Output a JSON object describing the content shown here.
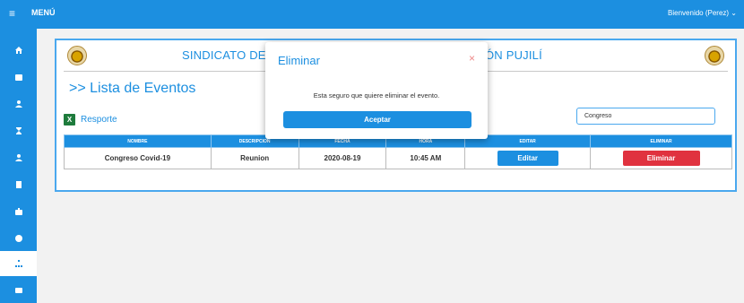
{
  "topbar": {
    "menu_icon": "≡",
    "menu_label": "MENÚ",
    "welcome": "Bienvenido (Perez) ⌄"
  },
  "sidebar": {
    "items": [
      {
        "icon": "home-icon"
      },
      {
        "icon": "calendar-icon"
      },
      {
        "icon": "user-icon"
      },
      {
        "icon": "hourglass-icon"
      },
      {
        "icon": "user-group-icon"
      },
      {
        "icon": "document-icon"
      },
      {
        "icon": "briefcase-icon"
      },
      {
        "icon": "circle-icon"
      },
      {
        "icon": "sitemap-icon"
      },
      {
        "icon": "card-icon"
      }
    ]
  },
  "panel": {
    "header_left": "SINDICATO DE C",
    "header_right": "ÓN PUJILÍ",
    "list_title": ">> Lista de Eventos",
    "report_icon": "X",
    "report_label": "Resporte",
    "search_value": "Congreso"
  },
  "table": {
    "headers": [
      "NOMBRE",
      "DESCRIPCION",
      "FECHA",
      "HORA",
      "EDITAR",
      "ELIMINAR"
    ],
    "rows": [
      {
        "nombre": "Congreso Covid-19",
        "descripcion": "Reunion",
        "fecha": "2020-08-19",
        "hora": "10:45 AM",
        "edit_label": "Editar",
        "delete_label": "Eliminar"
      }
    ]
  },
  "modal": {
    "title": "Eliminar",
    "close": "×",
    "message": "Esta seguro que quiere eliminar el evento.",
    "accept_label": "Aceptar"
  }
}
